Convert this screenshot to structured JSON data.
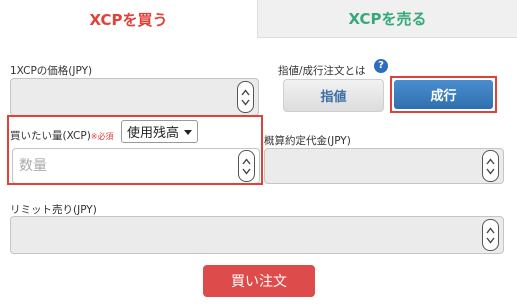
{
  "tabs": {
    "buy": "XCPを買う",
    "sell": "XCPを売る"
  },
  "price": {
    "label": "1XCPの価格(JPY)",
    "value": ""
  },
  "order_type": {
    "label": "指値/成行注文とは",
    "help": "?",
    "limit_label": "指値",
    "market_label": "成行",
    "selected": "成行"
  },
  "quantity": {
    "label": "買いたい量(XCP)",
    "required": "※必須",
    "dropdown_value": "使用残高",
    "placeholder": "数量"
  },
  "estimated_total": {
    "label": "概算約定代金(JPY)",
    "value": ""
  },
  "limit_sell": {
    "label": "リミット売り(JPY)",
    "value": ""
  },
  "submit_label": "買い注文",
  "colors": {
    "buy_accent": "#e0413a",
    "sell_accent": "#35a97a",
    "market_button": "#3a7fc0",
    "submit_button": "#de4b4b"
  }
}
